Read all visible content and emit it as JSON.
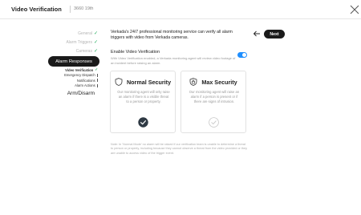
{
  "header": {
    "title": "Video Verification",
    "subtitle": "3660 19th"
  },
  "steps": {
    "general": "General",
    "alarm_triggers": "Alarm Triggers",
    "cameras": "Cameras",
    "alarm_responses": "Alarm Responses",
    "sub_video_verification": "Video Verification",
    "sub_emergency_dispatch": "Emergency Dispatch",
    "sub_notifications": "Notifications",
    "sub_alarm_actions": "Alarm Actions",
    "arm_disarm": "Arm/Disarm"
  },
  "main": {
    "intro": "Verkada's 24/7 professional monitoring service can verify all alarm triggers with video from Verkada cameras.",
    "next_label": "Next",
    "enable_label": "Enable Video Verification",
    "enable_desc": "With Video Verification enabled, a Verkada monitoring agent will review video footage of an incident before raising an alarm.",
    "toggle_on": true,
    "note": "Note: In 'Normal Mode' no alarm will be raised if our verification team is unable to determine a threat to person or property, including because they cannot observe a threat from the video provided or they are unable to access video of the trigger event."
  },
  "cards": {
    "normal": {
      "title": "Normal Security",
      "desc": "Our monitoring agent will only raise an alarm if there is a visible threat to a person or property.",
      "selected": true
    },
    "max": {
      "title": "Max Security",
      "desc": "Our monitoring agent will raise an alarm if a person is present or if there are signs of intrusion.",
      "selected": false
    }
  },
  "colors": {
    "accent": "#1f8fff",
    "success": "#27ae60",
    "dark": "#1a1a1a"
  }
}
